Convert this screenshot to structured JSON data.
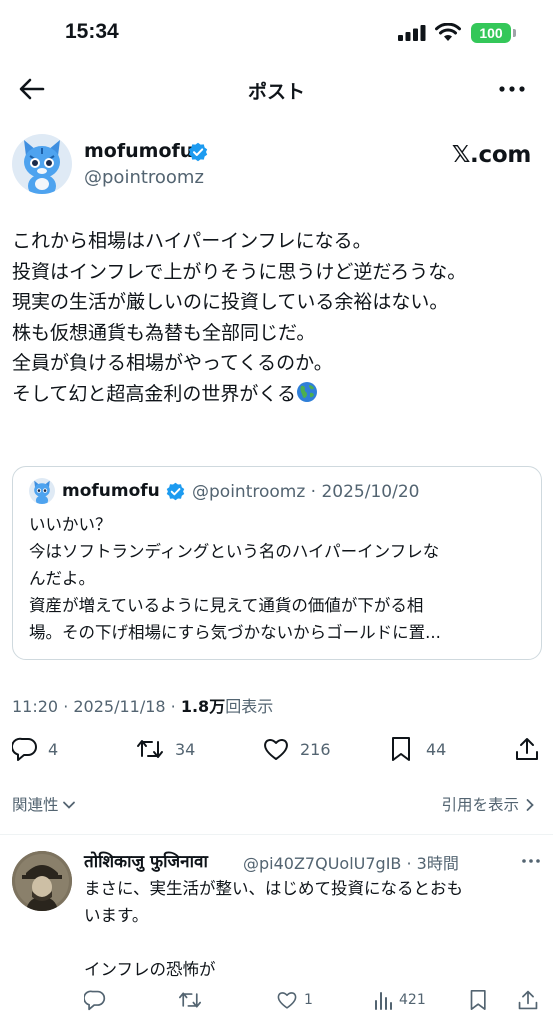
{
  "status_bar": {
    "time": "15:34",
    "battery": "100"
  },
  "nav": {
    "title": "ポスト"
  },
  "post": {
    "author_name": "mofumofu",
    "handle": "@pointroomz",
    "source": "𝕏.com",
    "lines": [
      "これから相場はハイパーインフレになる。",
      "投資はインフレで上がりそうに思うけど逆だろうな。",
      "現実の生活が厳しいのに投資している余裕はない。",
      "株も仮想通貨も為替も全部同じだ。",
      "全員が負ける相場がやってくるのか。",
      "そして幻と超高金利の世界がくる"
    ],
    "emoji": "globe-icon"
  },
  "quote": {
    "author_name": "mofumofu",
    "handle_date": "@pointroomz · 2025/10/20",
    "lines": [
      "いいかい？",
      "今はソフトランディングという名のハイパーインフレな",
      "んだよ。",
      "資産が増えているように見えて通貨の価値が下がる相",
      "場。その下げ相場にすら気づかないからゴールドに置..."
    ]
  },
  "meta": {
    "time_date": "11:20 · 2025/11/18 · ",
    "views": "1.8万",
    "views_label": "回表示"
  },
  "actions": {
    "replies": "4",
    "reposts": "34",
    "likes": "216",
    "bookmarks": "44"
  },
  "related": {
    "label": "関連性",
    "show_quotes": "引用を表示"
  },
  "reply": {
    "author_name": "तोशिकाजु फुजिनावा",
    "handle_time": "@pi40Z7QUolU7gIB · 3時間",
    "lines": [
      "まさに、実生活が整い、はじめて投資になるとおも",
      "います。",
      "",
      "インフレの恐怖が"
    ],
    "replies": "",
    "reposts": "",
    "likes": "1",
    "views": "421"
  },
  "colors": {
    "accent": "#1d9bf0",
    "secondary_text": "#536471",
    "battery": "#34c759"
  }
}
